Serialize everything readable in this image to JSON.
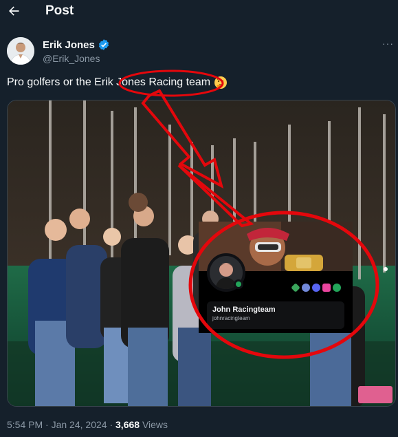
{
  "header": {
    "title": "Post",
    "back_icon": "arrow-left-icon"
  },
  "author": {
    "name": "Erik Jones",
    "handle": "@Erik_Jones",
    "verified": true,
    "verified_color": "#1d9bf0"
  },
  "tweet": {
    "text_before": "Pro golfers or the Erik ",
    "text_highlight": "Jones Racing team",
    "emoji": "thinking-face-icon"
  },
  "overlay_profile": {
    "display_name": "John Racingteam",
    "username": "johnracingteam",
    "status_color": "#23a55a"
  },
  "meta": {
    "time": "5:54 PM",
    "date": "Jan 24, 2024",
    "views_count": "3,668",
    "views_label": "Views"
  },
  "colors": {
    "background": "#15202b",
    "annotation": "#e4070c",
    "secondary_text": "#8b98a5"
  }
}
